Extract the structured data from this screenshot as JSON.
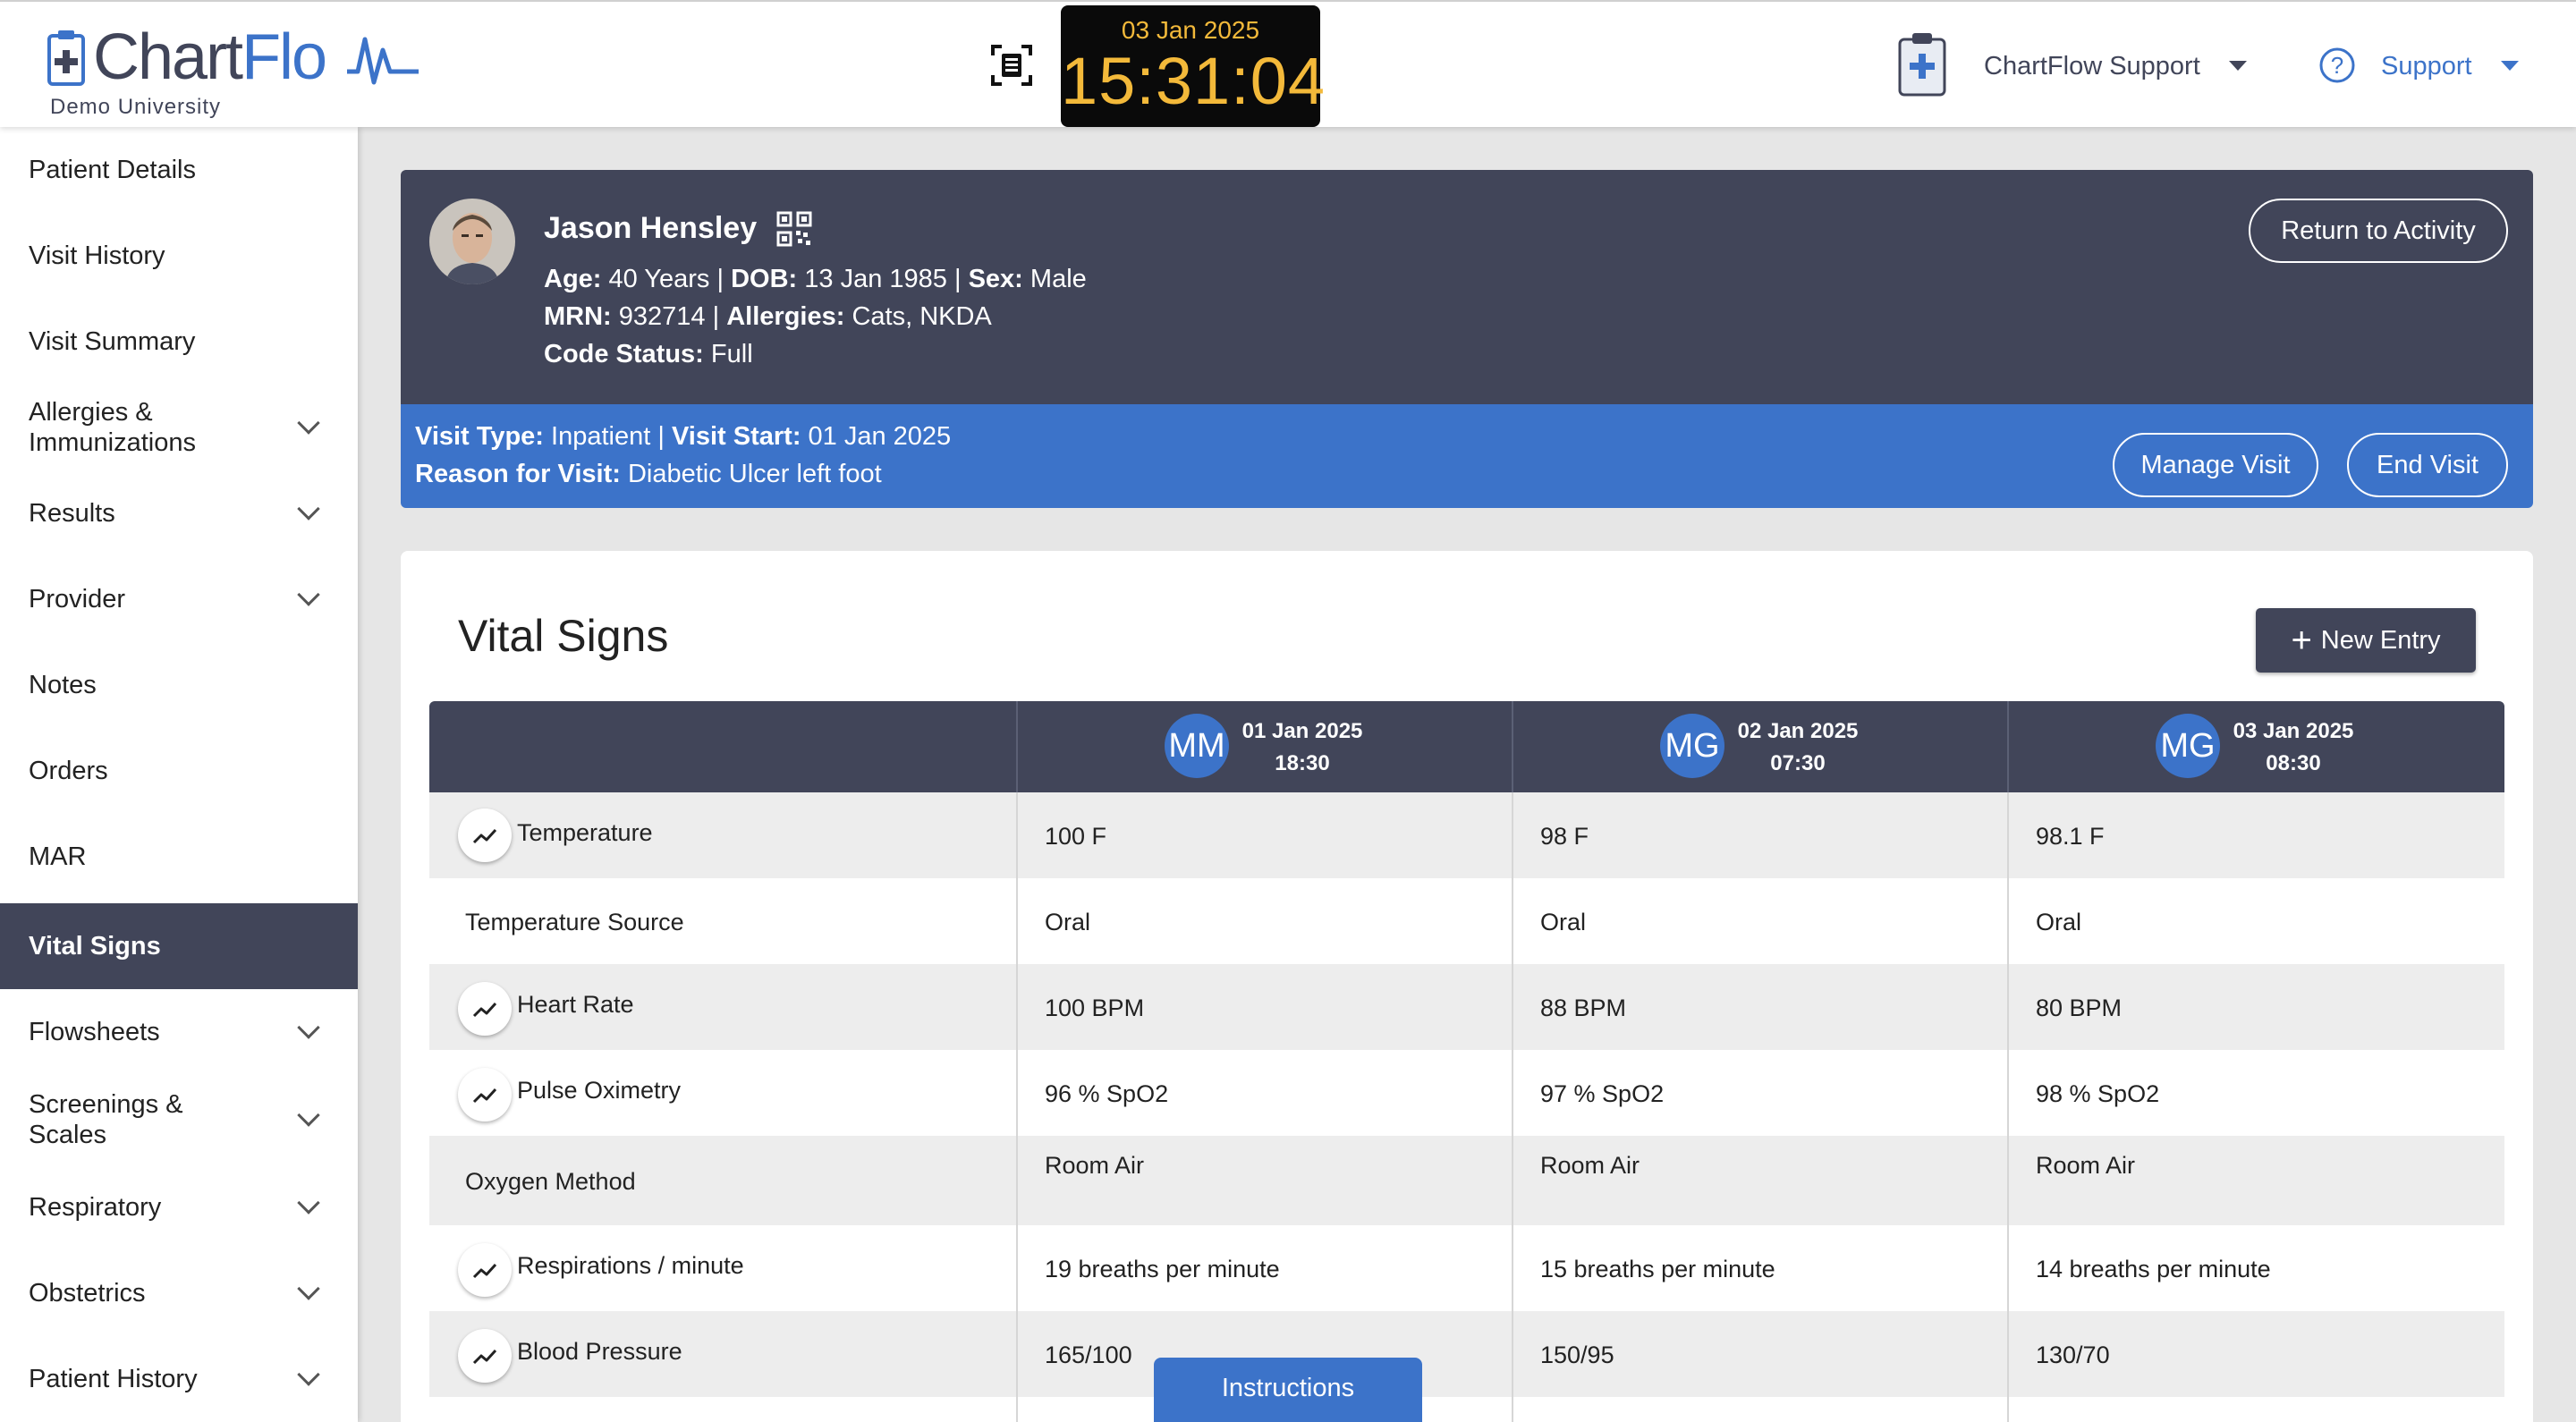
{
  "header": {
    "brand_chart": "Chart",
    "brand_flow": "Flo",
    "institution": "Demo University",
    "clock_date": "03 Jan 2025",
    "clock_time": "15:31:04",
    "user_menu": "ChartFlow Support",
    "help_menu": "Support"
  },
  "sidebar": {
    "items": [
      {
        "label": "Patient Details"
      },
      {
        "label": "Visit History"
      },
      {
        "label": "Visit Summary"
      },
      {
        "label": "Allergies & Immunizations"
      },
      {
        "label": "Results"
      },
      {
        "label": "Provider"
      },
      {
        "label": "Notes"
      },
      {
        "label": "Orders"
      },
      {
        "label": "MAR"
      },
      {
        "label": "Vital Signs",
        "active": true
      },
      {
        "label": "Flowsheets"
      },
      {
        "label": "Screenings & Scales"
      },
      {
        "label": "Respiratory"
      },
      {
        "label": "Obstetrics"
      },
      {
        "label": "Patient History"
      }
    ]
  },
  "patient": {
    "name": "Jason Hensley",
    "age_label": "Age:",
    "age": "40 Years",
    "dob_label": "DOB:",
    "dob": "13 Jan 1985",
    "sex_label": "Sex:",
    "sex": "Male",
    "mrn_label": "MRN:",
    "mrn": "932714",
    "allergies_label": "Allergies:",
    "allergies": "Cats, NKDA",
    "code_status_label": "Code Status:",
    "code_status": "Full",
    "sep": "|",
    "return_button": "Return to Activity"
  },
  "visit": {
    "type_label": "Visit Type:",
    "type": "Inpatient",
    "start_label": "Visit Start:",
    "start": "01 Jan 2025",
    "reason_label": "Reason for Visit:",
    "reason": "Diabetic Ulcer left foot",
    "manage_button": "Manage Visit",
    "end_button": "End Visit"
  },
  "vitals": {
    "title": "Vital Signs",
    "new_entry": "New Entry",
    "plus": "+",
    "columns": [
      {
        "initials": "MM",
        "date": "01 Jan 2025",
        "time": "18:30"
      },
      {
        "initials": "MG",
        "date": "02 Jan 2025",
        "time": "07:30"
      },
      {
        "initials": "MG",
        "date": "03 Jan 2025",
        "time": "08:30"
      }
    ],
    "rows": [
      {
        "label": "Temperature",
        "values": [
          "100 F",
          "98 F",
          "98.1 F"
        ]
      },
      {
        "label": "Temperature Source",
        "values": [
          "Oral",
          "Oral",
          "Oral"
        ]
      },
      {
        "label": "Heart Rate",
        "values": [
          "100 BPM",
          "88 BPM",
          "80 BPM"
        ]
      },
      {
        "label": "Pulse Oximetry",
        "values": [
          "96 % SpO2",
          "97 % SpO2",
          "98 % SpO2"
        ]
      },
      {
        "label": "Oxygen Method",
        "values": [
          "Room Air",
          "Room Air",
          "Room Air"
        ]
      },
      {
        "label": "Respirations / minute",
        "values": [
          "19 breaths per minute",
          "15 breaths per minute",
          "14 breaths per minute"
        ]
      },
      {
        "label": "Blood Pressure",
        "values": [
          "165/100",
          "150/95",
          "130/70"
        ]
      }
    ]
  },
  "instructions": "Instructions",
  "colors": {
    "navy": "#414559",
    "blue": "#3c73c9",
    "clock_amber": "#f3b93a"
  }
}
